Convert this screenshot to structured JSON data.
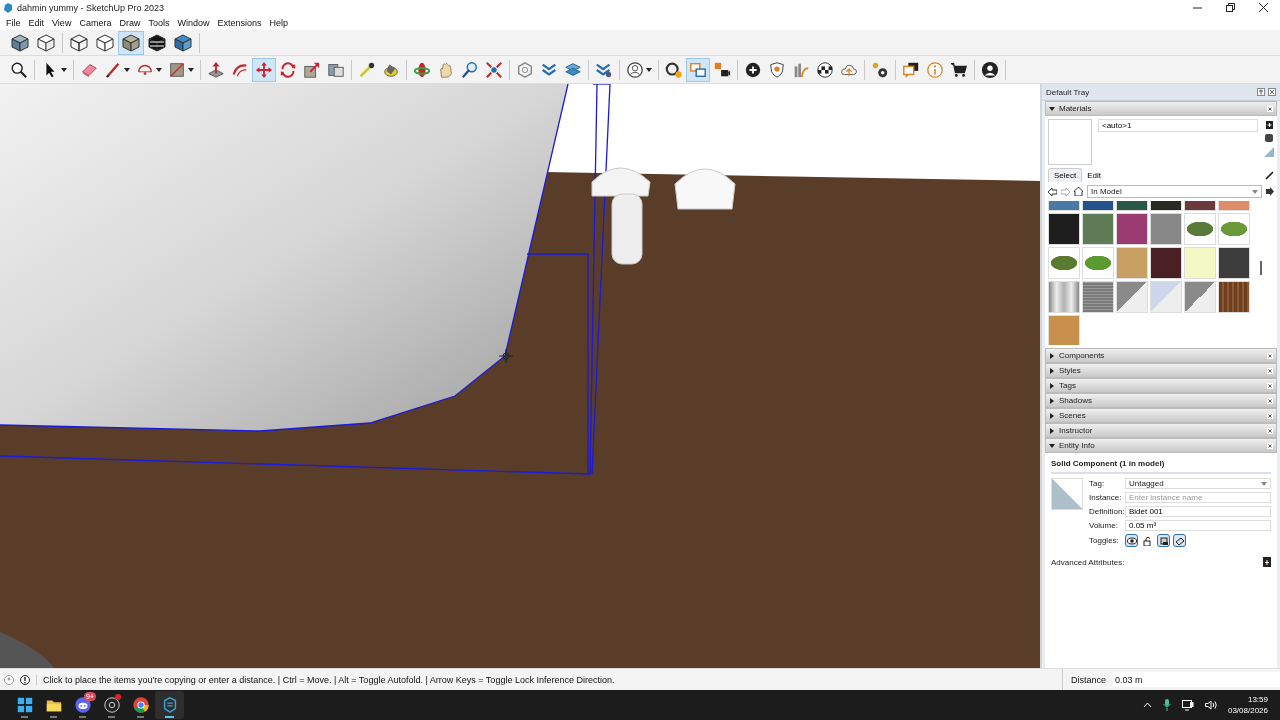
{
  "window": {
    "title": "dahmin yummy - SketchUp Pro 2023"
  },
  "menu": [
    "File",
    "Edit",
    "View",
    "Camera",
    "Draw",
    "Tools",
    "Window",
    "Extensions",
    "Help"
  ],
  "toolbars": [
    {
      "groups": [
        [
          {
            "selected": false
          },
          {
            "selected": false
          }
        ],
        [
          {
            "selected": false
          },
          {
            "selected": false
          },
          {
            "selected": true
          },
          {
            "selected": false
          },
          {
            "selected": false
          }
        ]
      ]
    },
    {
      "groups": [
        [
          {
            "selected": false
          }
        ],
        [
          {
            "selected": false,
            "dropdown": true
          }
        ],
        [
          {
            "selected": false
          },
          {
            "selected": false,
            "dropdown": true
          },
          {
            "selected": false,
            "dropdown": true
          },
          {
            "selected": false,
            "dropdown": true
          }
        ],
        [
          {
            "selected": false
          },
          {
            "selected": false
          },
          {
            "selected": true
          },
          {
            "selected": false
          },
          {
            "selected": false
          },
          {
            "selected": false
          }
        ],
        [
          {
            "selected": false
          },
          {
            "selected": false
          }
        ],
        [
          {
            "selected": false
          },
          {
            "selected": false
          },
          {
            "selected": false
          },
          {
            "selected": false
          }
        ],
        [
          {
            "selected": false
          },
          {
            "selected": false
          },
          {
            "selected": false
          }
        ],
        [
          {
            "selected": false
          }
        ],
        [
          {
            "selected": false,
            "dropdown": true
          }
        ],
        [
          {
            "selected": false
          },
          {
            "selected": true
          },
          {
            "selected": false
          }
        ],
        [
          {
            "selected": false
          },
          {
            "selected": false
          },
          {
            "selected": false
          },
          {
            "selected": false
          },
          {
            "selected": false
          }
        ],
        [
          {
            "selected": false
          }
        ],
        [
          {
            "selected": false
          },
          {
            "selected": false
          },
          {
            "selected": false
          }
        ],
        [
          {
            "selected": false
          }
        ]
      ]
    }
  ],
  "tray": {
    "title": "Default Tray",
    "panels": [
      {
        "kind": "materials",
        "title": "Materials",
        "expanded": true
      },
      {
        "kind": "plain",
        "title": "Components",
        "expanded": false
      },
      {
        "kind": "plain",
        "title": "Styles",
        "expanded": false
      },
      {
        "kind": "plain",
        "title": "Tags",
        "expanded": false
      },
      {
        "kind": "plain",
        "title": "Shadows",
        "expanded": false
      },
      {
        "kind": "plain",
        "title": "Scenes",
        "expanded": false
      },
      {
        "kind": "plain",
        "title": "Instructor",
        "expanded": false
      },
      {
        "kind": "entity_info",
        "title": "Entity Info",
        "expanded": true
      }
    ],
    "materials": {
      "name": "<auto>1",
      "tabs": [
        {
          "label": "Select",
          "selected": true
        },
        {
          "label": "Edit",
          "selected": false
        }
      ],
      "collection": "In Model",
      "swatches": [
        {
          "kind": "color",
          "color": "#4a79a6"
        },
        {
          "kind": "color",
          "color": "#24528a"
        },
        {
          "kind": "color",
          "color": "#2a5848"
        },
        {
          "kind": "color",
          "color": "#2a2a22"
        },
        {
          "kind": "color",
          "color": "#6a3a3c"
        },
        {
          "kind": "color",
          "color": "#e08c6c"
        },
        {
          "kind": "color",
          "color": "#1e1e1e"
        },
        {
          "kind": "color",
          "color": "#5e7a56"
        },
        {
          "kind": "color",
          "color": "#9a3c72"
        },
        {
          "kind": "color",
          "color": "#888888"
        },
        {
          "kind": "leaf",
          "color": "#5a7a3a"
        },
        {
          "kind": "leaf",
          "color": "#6a9a3a"
        },
        {
          "kind": "leaf",
          "color": "#5a7a30"
        },
        {
          "kind": "leaf",
          "color": "#5a9a30"
        },
        {
          "kind": "color",
          "color": "#c8a064"
        },
        {
          "kind": "color",
          "color": "#4a2024"
        },
        {
          "kind": "color",
          "color": "#f4f8c4"
        },
        {
          "kind": "color",
          "color": "#3c3c3c"
        },
        {
          "kind": "metal",
          "color": "#b0b0b0"
        },
        {
          "kind": "brushed",
          "color": "#7a7a7a"
        },
        {
          "kind": "split",
          "color": "#8a8a8a"
        },
        {
          "kind": "split",
          "color": "#cdd6ea"
        },
        {
          "kind": "split",
          "color": "#8a8a8a"
        },
        {
          "kind": "wood",
          "color": "#6e3e1e"
        },
        {
          "kind": "color",
          "color": "#c8904a"
        }
      ]
    },
    "entity_info": {
      "heading": "Solid Component (1 in model)",
      "fields": [
        {
          "kind": "dropdown",
          "label": "Tag:",
          "value": "Untagged"
        },
        {
          "kind": "input",
          "label": "Instance:",
          "placeholder": "Enter instance name"
        },
        {
          "kind": "input",
          "label": "Definition:",
          "value": "Bidet 001"
        },
        {
          "kind": "input",
          "label": "Volume:",
          "value": "0.05 m³"
        }
      ],
      "toggles_label": "Toggles:",
      "toggles": [
        {
          "on": true
        },
        {
          "on": false
        },
        {
          "on": true
        },
        {
          "on": true
        }
      ],
      "advanced_label": "Advanced Attributes:"
    }
  },
  "status_bar": {
    "message": "Click to place the items you're copying or enter a distance. | Ctrl = Move. | Alt = Toggle Autofold. | Arrow Keys = Toggle Lock Inference Direction.",
    "distance_label": "Distance",
    "distance_value": "0.03 m"
  },
  "taskbar": {
    "apps": [
      {
        "selected": false,
        "alert": false
      },
      {
        "selected": false,
        "alert": false
      },
      {
        "selected": false,
        "alert": false,
        "badge": "9+"
      },
      {
        "selected": false,
        "alert": true
      },
      {
        "selected": false,
        "alert": false
      },
      {
        "selected": true,
        "alert": false
      }
    ],
    "time": "13:59",
    "date": "03/08/2026"
  }
}
